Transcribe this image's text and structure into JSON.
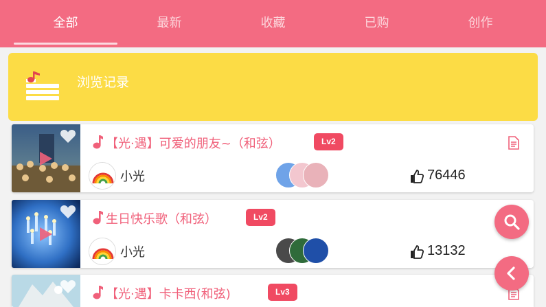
{
  "tabs": [
    {
      "label": "全部",
      "active": true
    },
    {
      "label": "最新",
      "active": false
    },
    {
      "label": "收藏",
      "active": false
    },
    {
      "label": "已购",
      "active": false
    },
    {
      "label": "创作",
      "active": false
    }
  ],
  "history": {
    "label": "浏览记录",
    "icon": "music-list-icon"
  },
  "songs": [
    {
      "title": "【光·遇】可爱的朋友~（和弦）",
      "level": "Lv2",
      "author": "小光",
      "likes": "76446"
    },
    {
      "title": "生日快乐歌（和弦）",
      "level": "Lv2",
      "author": "小光",
      "likes": "13132"
    },
    {
      "title": "【光·遇】卡卡西(和弦)",
      "level": "Lv3"
    }
  ],
  "colors": {
    "accent": "#f36b82",
    "banner": "#fcdc45",
    "title": "#f0607a",
    "level_badge": "#f04a62"
  },
  "fabs": [
    {
      "icon": "search-icon"
    },
    {
      "icon": "chevron-left-icon"
    }
  ]
}
